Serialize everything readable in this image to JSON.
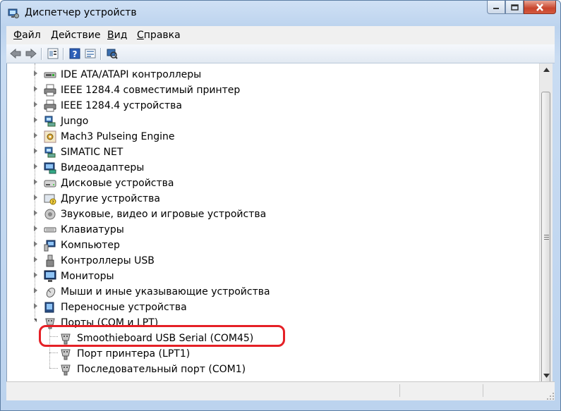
{
  "window": {
    "title": "Диспетчер устройств"
  },
  "menu": [
    {
      "first": "Ф",
      "rest": "айл"
    },
    {
      "first": "Д",
      "rest": "ействие"
    },
    {
      "first": "В",
      "rest": "ид"
    },
    {
      "first": "С",
      "rest": "правка"
    }
  ],
  "toolbar": {
    "buttons": [
      "back-icon",
      "forward-icon",
      "properties-icon",
      "help-icon",
      "details-icon",
      "scan-hardware-icon"
    ]
  },
  "tree": {
    "items": [
      {
        "label": "IDE ATA/ATAPI контроллеры",
        "icon": "ide-controller-icon"
      },
      {
        "label": "IEEE 1284.4 совместимый принтер",
        "icon": "printer-icon"
      },
      {
        "label": "IEEE 1284.4 устройства",
        "icon": "printer-icon"
      },
      {
        "label": "Jungo",
        "icon": "network-device-icon"
      },
      {
        "label": "Mach3 Pulseing Engine",
        "icon": "gear-device-icon"
      },
      {
        "label": "SIMATIC NET",
        "icon": "network-device-icon"
      },
      {
        "label": "Видеоадаптеры",
        "icon": "display-adapter-icon"
      },
      {
        "label": "Дисковые устройства",
        "icon": "disk-drive-icon"
      },
      {
        "label": "Другие устройства",
        "icon": "unknown-device-icon"
      },
      {
        "label": "Звуковые, видео и игровые устройства",
        "icon": "speaker-icon"
      },
      {
        "label": "Клавиатуры",
        "icon": "keyboard-icon"
      },
      {
        "label": "Компьютер",
        "icon": "computer-icon"
      },
      {
        "label": "Контроллеры USB",
        "icon": "usb-icon"
      },
      {
        "label": "Мониторы",
        "icon": "monitor-icon"
      },
      {
        "label": "Мыши и иные указывающие устройства",
        "icon": "mouse-icon"
      },
      {
        "label": "Переносные устройства",
        "icon": "portable-device-icon"
      },
      {
        "label": "Порты (COM и LPT)",
        "icon": "port-icon",
        "expanded": true
      }
    ],
    "ports_children": [
      {
        "label": "Smoothieboard USB Serial (COM45)",
        "icon": "port-icon"
      },
      {
        "label": "Порт принтера (LPT1)",
        "icon": "port-icon"
      },
      {
        "label": "Последовательный порт (COM1)",
        "icon": "port-icon"
      }
    ]
  },
  "colors": {
    "highlight": "#e52026",
    "titlebar": "#bcd3ee"
  }
}
